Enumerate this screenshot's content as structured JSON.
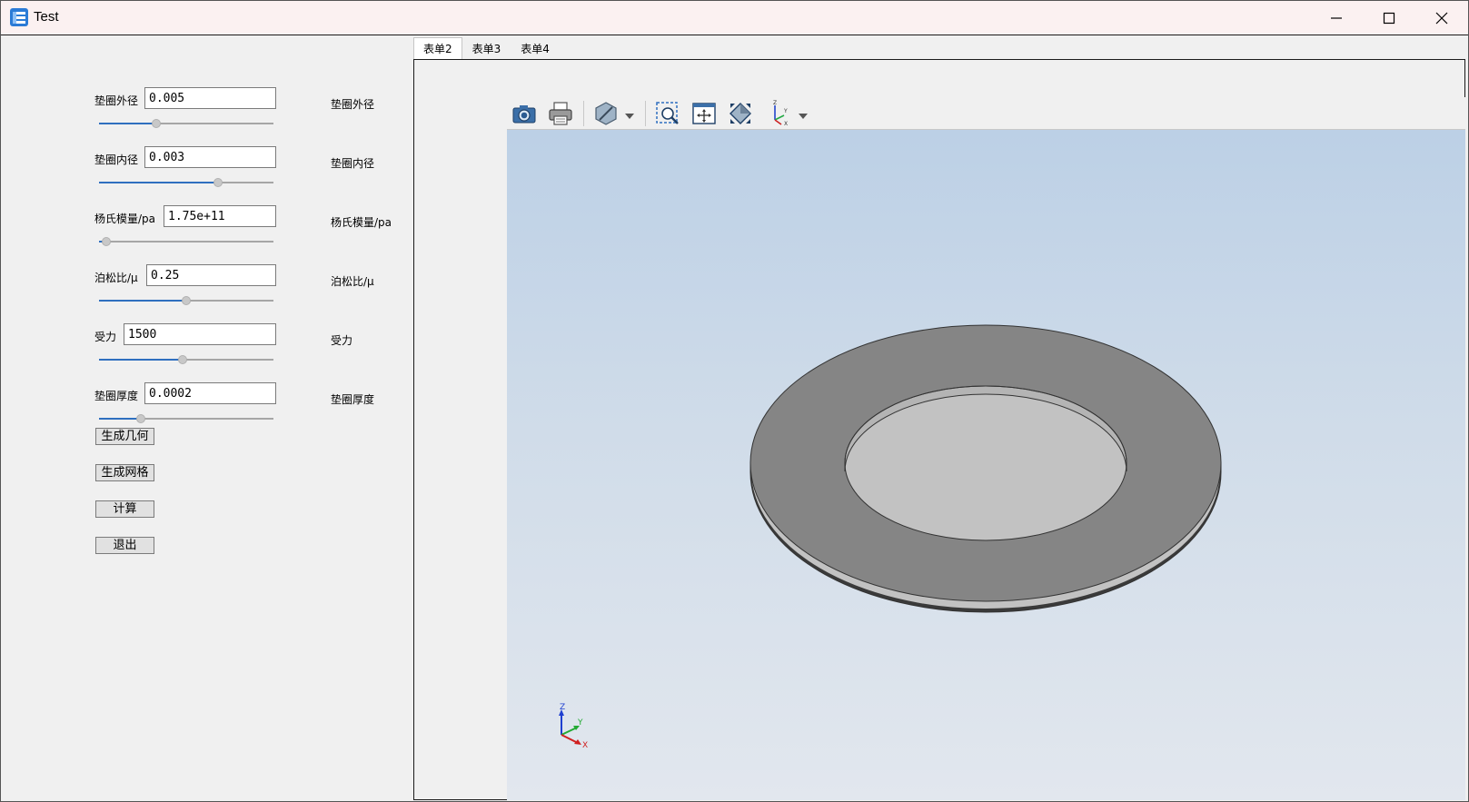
{
  "window": {
    "title": "Test"
  },
  "params": [
    {
      "label": "垫圈外径",
      "value": "0.005",
      "side_label": "垫圈外径",
      "slider_level": 0.33
    },
    {
      "label": "垫圈内径",
      "value": "0.003",
      "side_label": "垫圈内径",
      "slider_level": 0.68
    },
    {
      "label": "杨氏模量/pa",
      "value": "1.75e+11",
      "side_label": "杨氏模量/pa",
      "slider_level": 0.04
    },
    {
      "label": "泊松比/μ",
      "value": "0.25",
      "side_label": "泊松比/μ",
      "slider_level": 0.5
    },
    {
      "label": "受力",
      "value": "1500",
      "side_label": "受力",
      "slider_level": 0.48
    },
    {
      "label": "垫圈厚度",
      "value": "0.0002",
      "side_label": "垫圈厚度",
      "slider_level": 0.24
    }
  ],
  "buttons": {
    "generate_geometry": "生成几何",
    "generate_mesh": "生成网格",
    "compute": "计算",
    "exit": "退出"
  },
  "tabs": [
    "表单2",
    "表单3",
    "表单4"
  ],
  "active_tab": "表单2",
  "toolbar": {
    "tools": [
      "camera-icon",
      "print-icon",
      "display-mode-icon",
      "zoom-box-icon",
      "fit-all-icon",
      "fit-selection-icon",
      "axes-view-icon"
    ]
  },
  "triad": {
    "z": "Z",
    "y": "Y",
    "x": "X"
  },
  "colors": {
    "accent": "#2f6fbf",
    "washer_top": "#858585",
    "washer_side": "#bdbdbd",
    "sky_top": "#bcd0e6",
    "sky_bottom": "#e2e7ee"
  }
}
